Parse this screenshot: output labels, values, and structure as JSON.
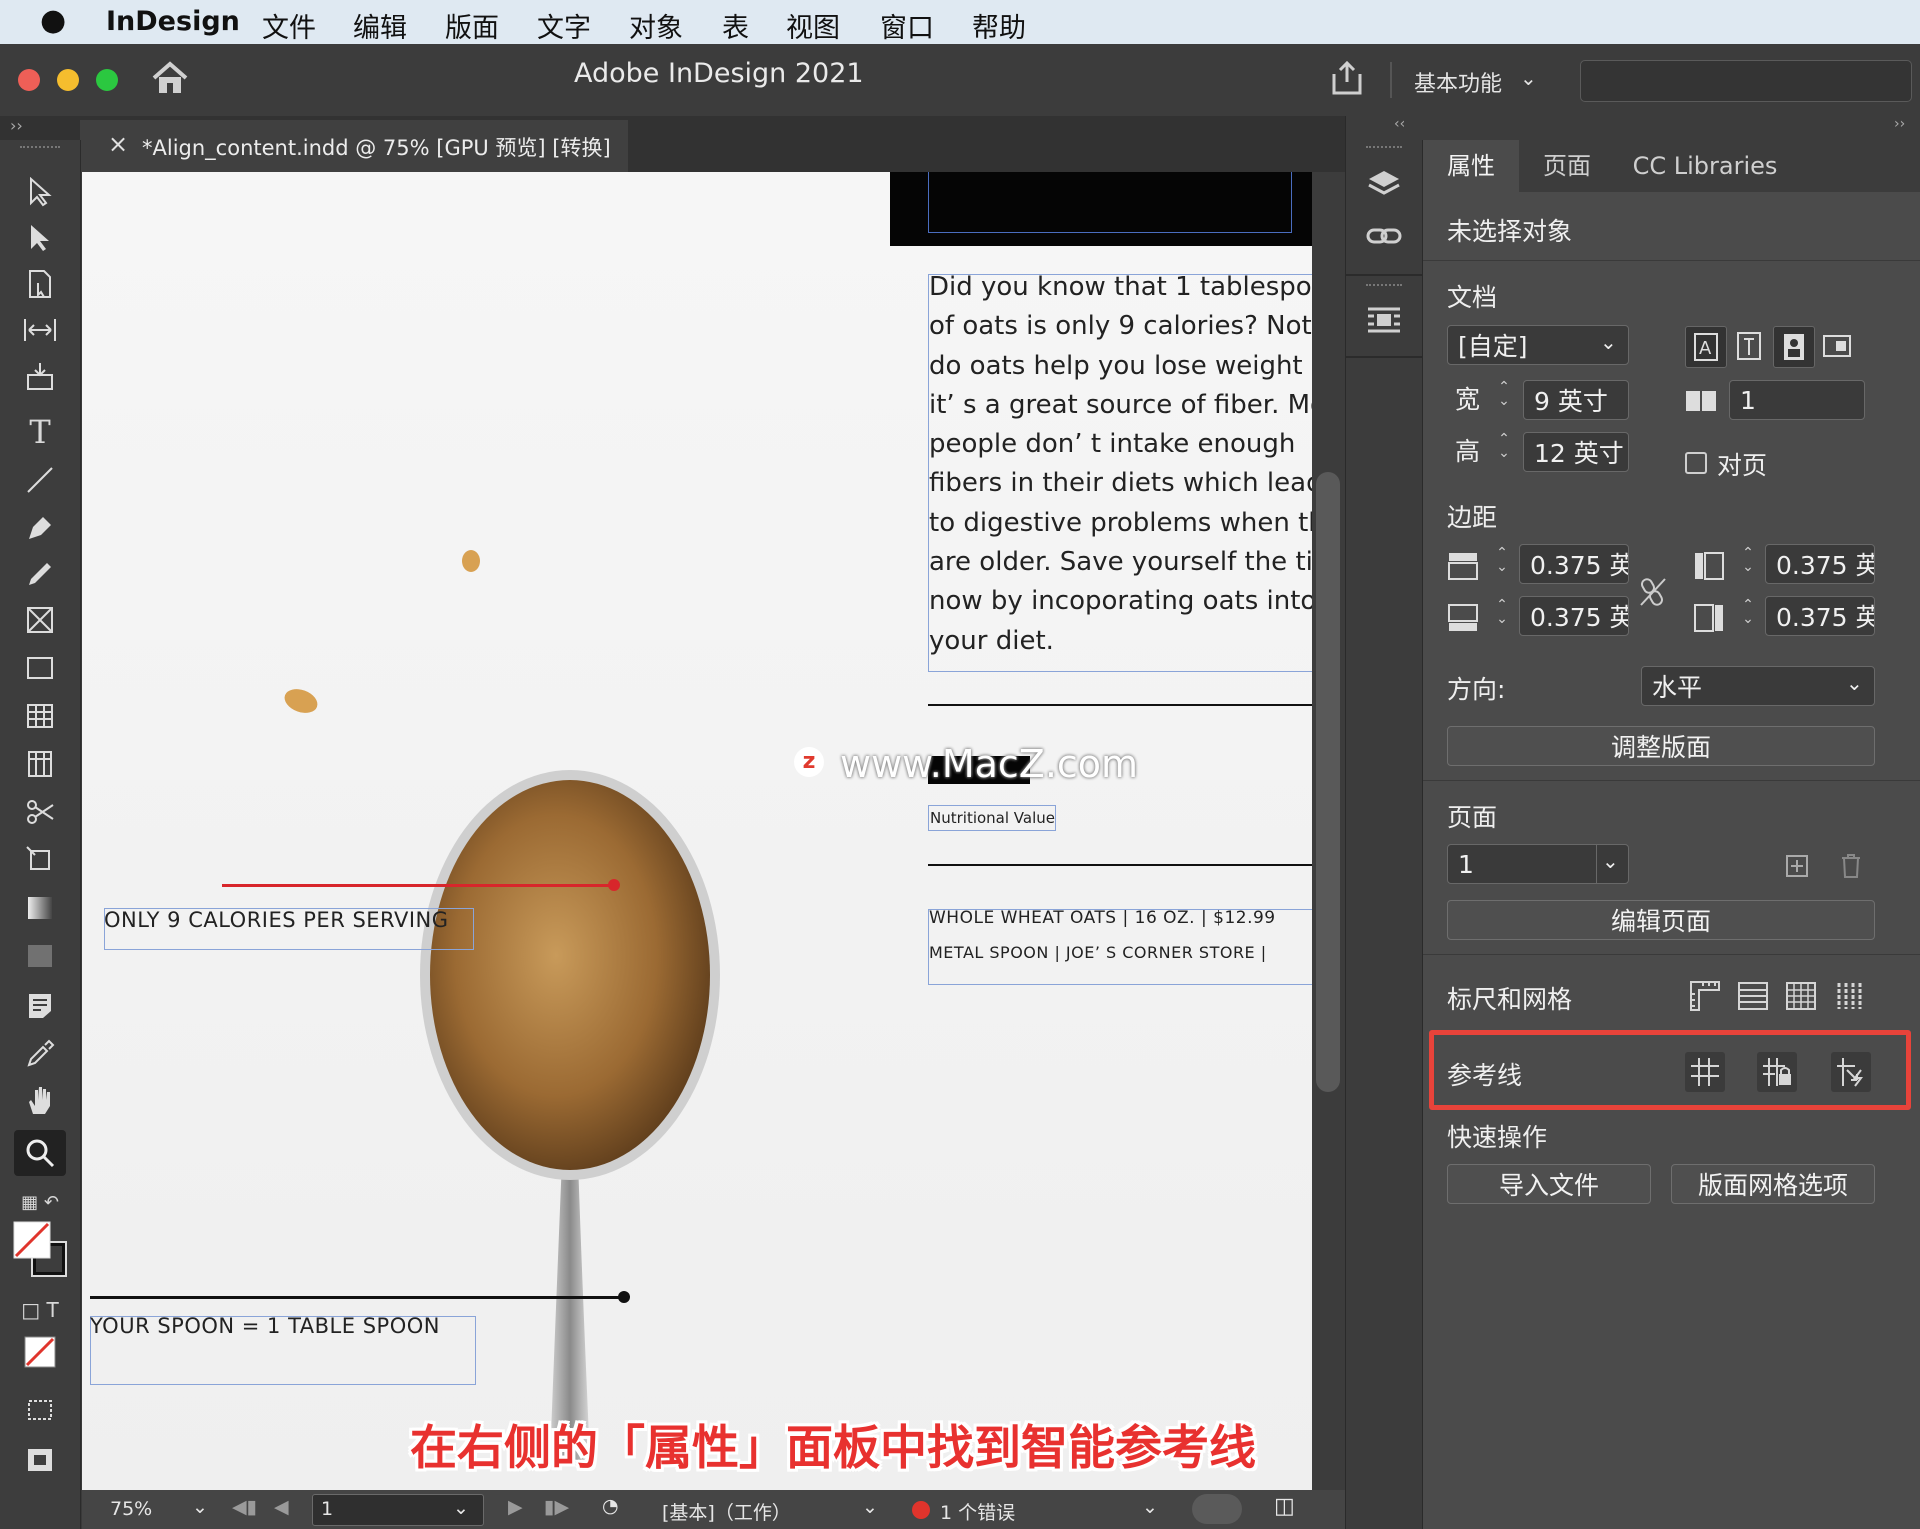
{
  "menubar": {
    "apple_icon": "apple-logo",
    "app_name": "InDesign",
    "items": [
      "文件",
      "编辑",
      "版面",
      "文字",
      "对象",
      "表",
      "视图",
      "窗口",
      "帮助"
    ]
  },
  "titlebar": {
    "title": "Adobe InDesign 2021",
    "workspace": "基本功能",
    "home_icon": "home-icon",
    "share_icon": "share-icon"
  },
  "document_tab": {
    "label": "*Align_content.indd @ 75% [GPU 预览] [转换]",
    "close": "×"
  },
  "panel": {
    "tabs": [
      "属性",
      "页面",
      "CC Libraries"
    ],
    "no_selection": "未选择对象",
    "document": {
      "heading": "文档",
      "preset": "[自定]",
      "width_label": "宽",
      "width_value": "9 英寸",
      "height_label": "高",
      "height_value": "12 英寸",
      "pages_value": "1",
      "facing_pages": "对页"
    },
    "margins": {
      "heading": "边距",
      "top": "0.375 英",
      "bottom": "0.375 英",
      "left": "0.375 英",
      "right": "0.375 英"
    },
    "orientation": {
      "label": "方向:",
      "value": "水平"
    },
    "adjust_layout": "调整版面",
    "page": {
      "heading": "页面",
      "value": "1",
      "edit_page": "编辑页面"
    },
    "rulers_grids": "标尺和网格",
    "guides": "参考线",
    "quick_actions": {
      "heading": "快速操作",
      "import_file": "导入文件",
      "layout_grid_options": "版面网格选项"
    },
    "highlight_color": "#e8433a"
  },
  "canvas": {
    "body_lines": [
      "Did you know that 1 tablespoo",
      "of oats is only 9 calories? Not o",
      "do oats help you lose weight b",
      "it’ s a great source of fiber. Mo",
      "people don’ t intake enough",
      "fibers in their diets which leads",
      "to digestive problems when th",
      "are older. Save yourself the tim",
      "now by incoporating oats into",
      "your diet."
    ],
    "nutrition_label": "Nutritional Value",
    "product_line": "WHOLE WHEAT OATS | 16 OZ. | $12.99",
    "store_line": "METAL SPOON | JOE’ S CORNER STORE |",
    "calories_caption": "ONLY 9 CALORIES PER SERVING",
    "spoon_caption": "YOUR SPOON = 1 TABLE SPOON",
    "watermark": "www.MacZ.com",
    "subtitle": "在右侧的「属性」面板中找到智能参考线"
  },
  "statusbar": {
    "zoom": "75%",
    "page": "1",
    "style": "[基本]（工作）",
    "errors": "1 个错误",
    "error_color": "#e0342c"
  }
}
